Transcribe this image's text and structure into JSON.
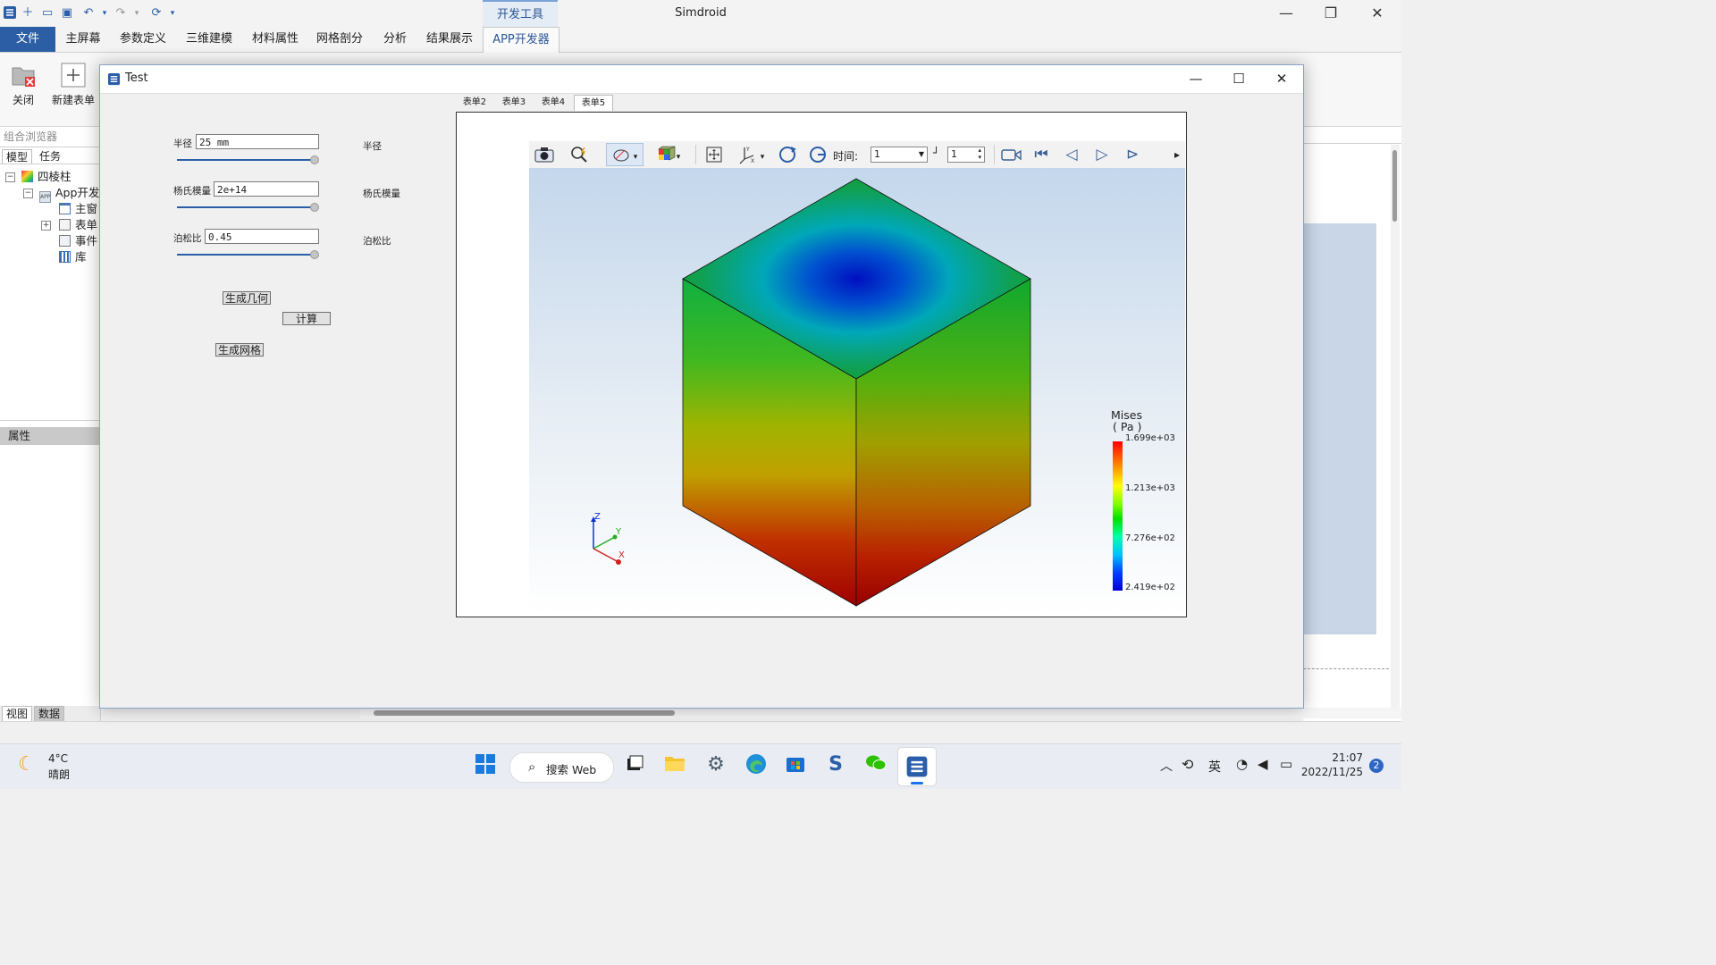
{
  "app": {
    "title": "Simdroid",
    "devtools_tab": "开发工具",
    "minimize": "—",
    "restore": "❐",
    "close": "✕"
  },
  "menu": {
    "items": [
      "文件",
      "主屏幕",
      "参数定义",
      "三维建模",
      "材料属性",
      "网格剖分",
      "分析",
      "结果展示",
      "APP开发器"
    ]
  },
  "ribbon": {
    "close_label": "关闭",
    "new_form_label": "新建表单"
  },
  "browser": {
    "title": "组合浏览器",
    "tabs": [
      "模型",
      "任务"
    ],
    "tree": [
      {
        "label": "四棱柱",
        "icon": "colorful-model-icon"
      },
      {
        "label": "App开发",
        "icon": "app-icon"
      },
      {
        "label": "主窗",
        "icon": "window-icon"
      },
      {
        "label": "表单",
        "icon": "form-icon"
      },
      {
        "label": "事件",
        "icon": "event-icon"
      },
      {
        "label": "库",
        "icon": "library-icon"
      }
    ],
    "properties": "属性",
    "bottom_tabs": [
      "视图",
      "数据"
    ]
  },
  "dialog": {
    "title": "Test",
    "fields": [
      {
        "label": "半径",
        "value": "25 mm",
        "side_label": "半径"
      },
      {
        "label": "杨氏模量",
        "value": "2e+14",
        "side_label": "杨氏模量"
      },
      {
        "label": "泊松比",
        "value": "0.45",
        "side_label": "泊松比"
      }
    ],
    "buttons": {
      "geometry": "生成几何",
      "compute": "计算",
      "mesh": "生成网格"
    },
    "form_tabs": [
      "表单2",
      "表单3",
      "表单4",
      "表单5"
    ],
    "active_form_tab": "表单5"
  },
  "viewer": {
    "time_label": "时间:",
    "time_value": "1",
    "step_value": "1",
    "legend": {
      "title": "Mises",
      "unit": "( Pa )",
      "ticks": [
        "1.699e+03",
        "1.213e+03",
        "7.276e+02",
        "2.419e+02"
      ]
    },
    "axes": {
      "x": "X",
      "y": "Y",
      "z": "Z"
    }
  },
  "taskbar": {
    "weather_temp": "4°C",
    "weather_desc": "晴朗",
    "search_label": "搜索 Web",
    "ime": "英",
    "time": "21:07",
    "date": "2022/11/25",
    "notifications": "2"
  }
}
